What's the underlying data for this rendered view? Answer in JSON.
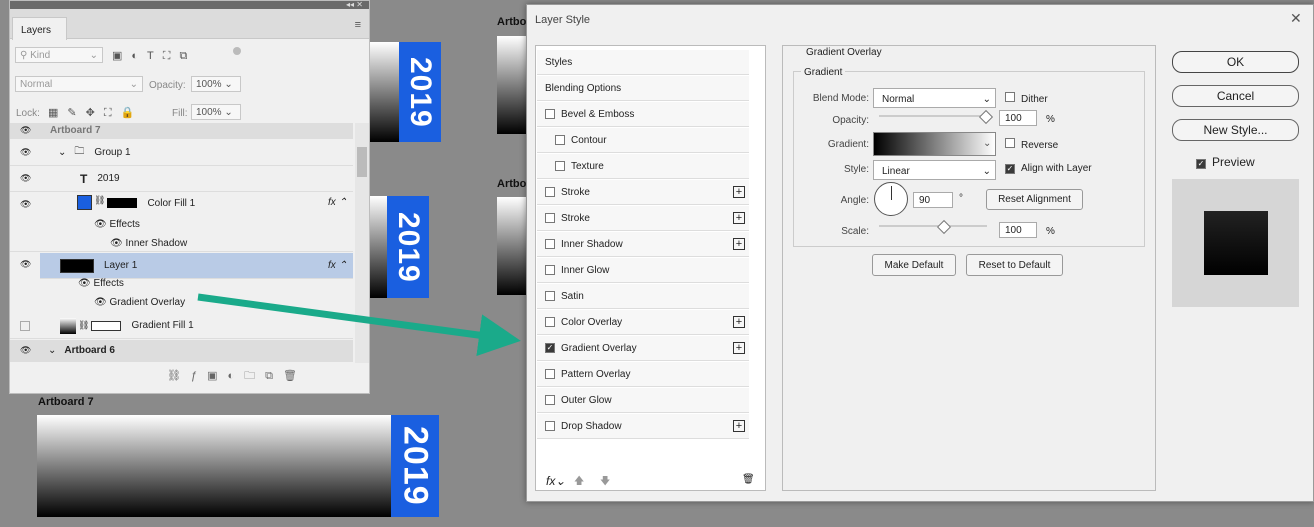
{
  "layers_panel": {
    "tab_label": "Layers",
    "kind_placeholder": "Kind",
    "blend_mode": "Normal",
    "opacity_label": "Opacity:",
    "opacity_value": "100%",
    "lock_label": "Lock:",
    "fill_label": "Fill:",
    "fill_value": "100%",
    "artboard7_cut": "Artboard 7",
    "group1": "Group 1",
    "text_layer": "2019",
    "color_fill": "Color Fill 1",
    "effects1": "Effects",
    "inner_shadow": "Inner Shadow",
    "layer1": "Layer 1",
    "effects2": "Effects",
    "gradient_overlay": "Gradient Overlay",
    "gradient_fill": "Gradient Fill 1",
    "artboard6": "Artboard 6"
  },
  "canvas": {
    "artboard7_label": "Artboard 7",
    "year_text": "2019",
    "artb_cut1": "Artbo",
    "artb_cut2": "Artbo"
  },
  "dialog": {
    "title": "Layer Style",
    "styles_header": "Styles",
    "blending_options": "Blending Options",
    "items": [
      {
        "label": "Bevel & Emboss",
        "checked": false,
        "plus": false,
        "indent": false
      },
      {
        "label": "Contour",
        "checked": false,
        "plus": false,
        "indent": true
      },
      {
        "label": "Texture",
        "checked": false,
        "plus": false,
        "indent": true
      },
      {
        "label": "Stroke",
        "checked": false,
        "plus": true,
        "indent": false
      },
      {
        "label": "Stroke",
        "checked": false,
        "plus": true,
        "indent": false
      },
      {
        "label": "Inner Shadow",
        "checked": false,
        "plus": true,
        "indent": false
      },
      {
        "label": "Inner Glow",
        "checked": false,
        "plus": false,
        "indent": false
      },
      {
        "label": "Satin",
        "checked": false,
        "plus": false,
        "indent": false
      },
      {
        "label": "Color Overlay",
        "checked": false,
        "plus": true,
        "indent": false
      },
      {
        "label": "Gradient Overlay",
        "checked": true,
        "plus": true,
        "indent": false
      },
      {
        "label": "Pattern Overlay",
        "checked": false,
        "plus": false,
        "indent": false
      },
      {
        "label": "Outer Glow",
        "checked": false,
        "plus": false,
        "indent": false
      },
      {
        "label": "Drop Shadow",
        "checked": false,
        "plus": true,
        "indent": false
      }
    ],
    "section_title": "Gradient Overlay",
    "subsection_title": "Gradient",
    "blend_mode_label": "Blend Mode:",
    "blend_mode_value": "Normal",
    "dither_label": "Dither",
    "opacity_label": "Opacity:",
    "opacity_value": "100",
    "opacity_unit": "%",
    "gradient_label": "Gradient:",
    "reverse_label": "Reverse",
    "style_label": "Style:",
    "style_value": "Linear",
    "align_label": "Align with Layer",
    "angle_label": "Angle:",
    "angle_value": "90",
    "angle_unit": "°",
    "reset_alignment": "Reset Alignment",
    "scale_label": "Scale:",
    "scale_value": "100",
    "scale_unit": "%",
    "make_default": "Make Default",
    "reset_default": "Reset to Default",
    "ok": "OK",
    "cancel": "Cancel",
    "new_style": "New Style...",
    "preview_label": "Preview",
    "fx_label": "fx"
  },
  "colors": {
    "accent_blue": "#1a5fe0",
    "arrow_green": "#1aaa8a"
  }
}
